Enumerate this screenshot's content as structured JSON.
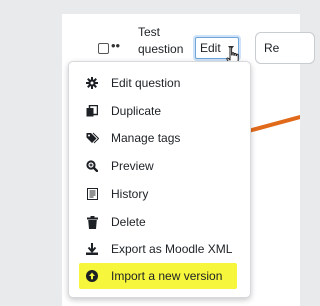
{
  "question": {
    "name_line1": "Test",
    "name_line2": "question",
    "dots": "••"
  },
  "edit_button": {
    "label": "Edit"
  },
  "right_button": {
    "label": "Re"
  },
  "menu": {
    "items": [
      {
        "label": "Edit question",
        "icon": "gear-icon"
      },
      {
        "label": "Duplicate",
        "icon": "copy-icon"
      },
      {
        "label": "Manage tags",
        "icon": "tag-icon"
      },
      {
        "label": "Preview",
        "icon": "zoom-icon"
      },
      {
        "label": "History",
        "icon": "history-list-icon"
      },
      {
        "label": "Delete",
        "icon": "trash-icon"
      },
      {
        "label": "Export as Moodle XML",
        "icon": "download-icon"
      },
      {
        "label": "Import a new version",
        "icon": "arrow-circle-icon"
      }
    ],
    "highlight_color": "#f6f63c"
  },
  "annotation": {
    "arrow_color": "#e06a1a"
  },
  "colors": {
    "link": "#0f6cbf",
    "focus_ring": "#6ea6db"
  }
}
